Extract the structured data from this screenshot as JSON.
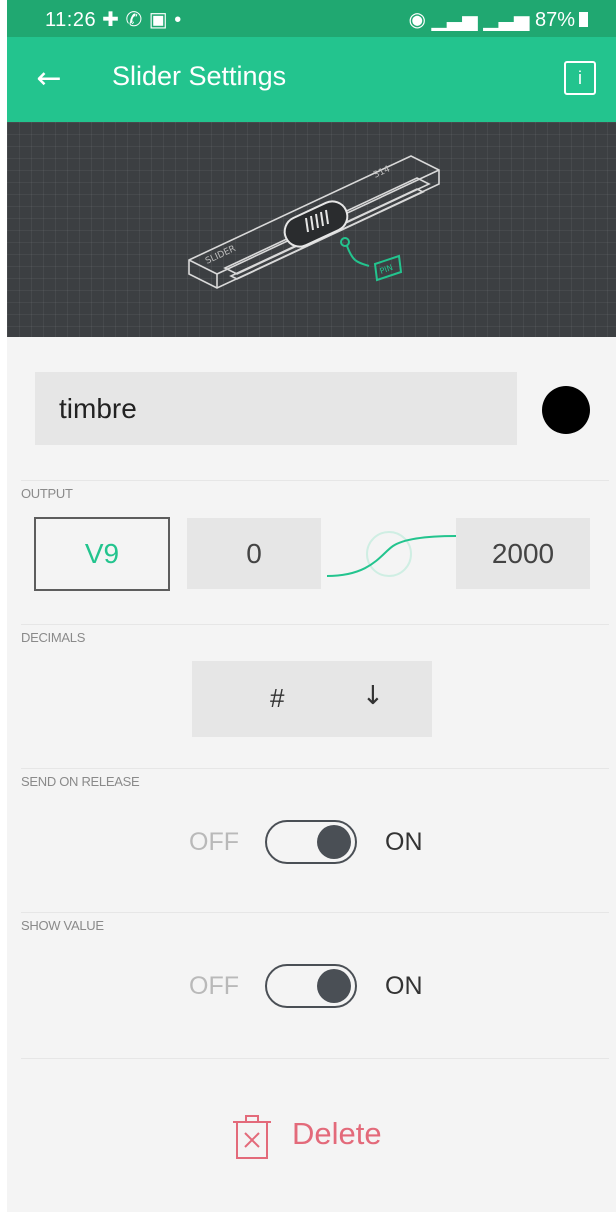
{
  "status_bar": {
    "time": "11:26",
    "left_icons": [
      "cross-icon",
      "whatsapp-icon",
      "message-icon",
      "dot-icon"
    ],
    "right_icons": [
      "hotspot-icon",
      "signal-icon",
      "signal-4g-icon",
      "signal-icon",
      "battery-icon"
    ],
    "battery": "87%"
  },
  "header": {
    "title": "Slider Settings",
    "back_icon": "arrow-left-icon",
    "info_icon": "info-icon",
    "info_glyph": "i"
  },
  "preview": {
    "widget_label": "SLIDER",
    "widget_value": "314",
    "pin_label": "PIN"
  },
  "widget": {
    "name": "timbre",
    "color": "#000000"
  },
  "output": {
    "label": "OUTPUT",
    "pin": "V9",
    "min": "0",
    "max": "2000",
    "accent_color": "#23c48e"
  },
  "decimals": {
    "label": "DECIMALS",
    "value": "#",
    "arrow": "↓"
  },
  "send_on_release": {
    "label": "SEND ON RELEASE",
    "off": "OFF",
    "on": "ON",
    "state": true
  },
  "show_value": {
    "label": "SHOW VALUE",
    "off": "OFF",
    "on": "ON",
    "state": true
  },
  "delete": {
    "label": "Delete",
    "icon": "trash-icon",
    "color": "#e36a7a"
  }
}
